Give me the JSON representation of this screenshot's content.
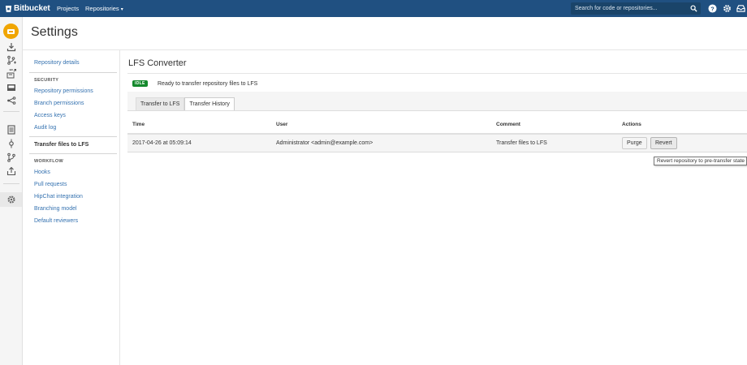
{
  "topbar": {
    "brand": "Bitbucket",
    "nav": {
      "projects": "Projects",
      "repositories": "Repositories"
    },
    "search_placeholder": "Search for code or repositories...",
    "icons": [
      "search-icon",
      "help-icon",
      "gear-icon",
      "inbox-icon"
    ],
    "colors": {
      "bar": "#205081"
    }
  },
  "iconbar": {
    "items": [
      "repository-avatar",
      "clone-icon",
      "create-branch-icon",
      "create-pull-request-icon",
      "fork-icon",
      "share-icon",
      "source-icon",
      "commits-icon",
      "branches-icon",
      "pull-requests-icon",
      "repository-settings-icon"
    ]
  },
  "page": {
    "title": "Settings"
  },
  "settings_nav": {
    "repository_details": "Repository details",
    "security_heading": "SECURITY",
    "security_items": [
      "Repository permissions",
      "Branch permissions",
      "Access keys",
      "Audit log"
    ],
    "active_item": "Transfer files to LFS",
    "workflow_heading": "WORKFLOW",
    "workflow_items": [
      "Hooks",
      "Pull requests",
      "HipChat integration",
      "Branching model",
      "Default reviewers"
    ]
  },
  "main": {
    "heading": "LFS Converter",
    "status": {
      "badge": "IDLE",
      "text": "Ready to transfer repository files to LFS",
      "badge_color": "#14892c"
    },
    "tabs": [
      "Transfer to LFS",
      "Transfer History"
    ],
    "active_tab": "Transfer History",
    "table": {
      "columns": [
        "Time",
        "User",
        "Comment",
        "Actions"
      ],
      "rows": [
        {
          "time": "2017-04-26 at 05:09:14",
          "user": "Administrator <admin@example.com>",
          "comment": "Transfer files to LFS",
          "actions": [
            "Purge",
            "Revert"
          ]
        }
      ]
    },
    "tooltip": "Revert repository to pre-transfer state"
  }
}
